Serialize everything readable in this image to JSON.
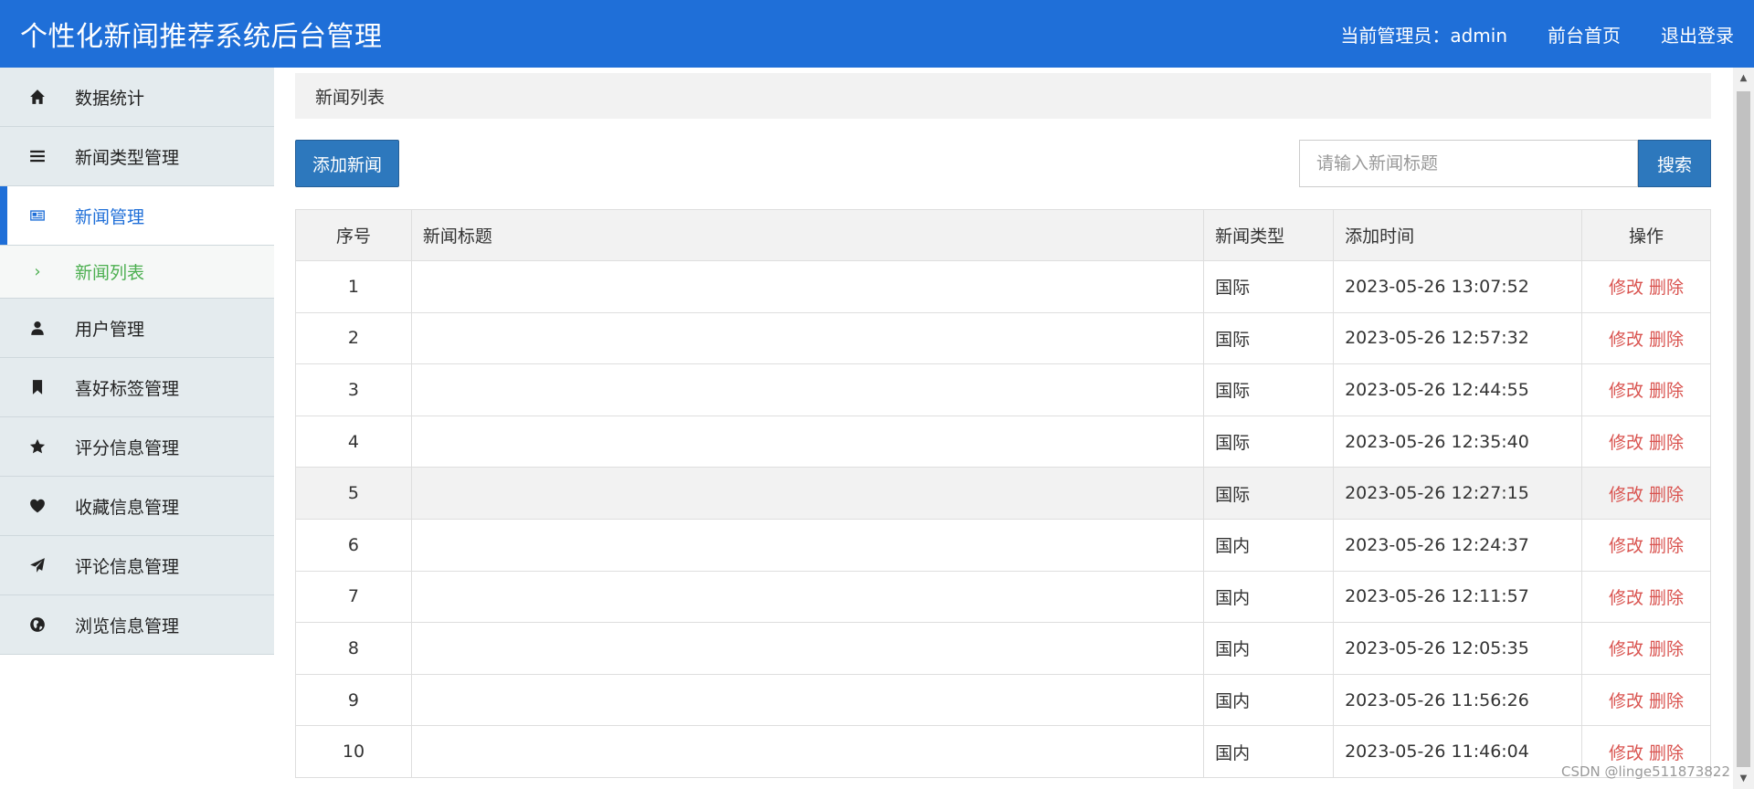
{
  "header": {
    "title": "个性化新闻推荐系统后台管理",
    "admin_label": "当前管理员：admin",
    "home_link": "前台首页",
    "logout_link": "退出登录"
  },
  "sidebar": {
    "items": [
      {
        "label": "数据统计",
        "icon": "home-icon"
      },
      {
        "label": "新闻类型管理",
        "icon": "menu-icon"
      },
      {
        "label": "新闻管理",
        "icon": "newspaper-icon",
        "active": true
      },
      {
        "label": "用户管理",
        "icon": "user-icon"
      },
      {
        "label": "喜好标签管理",
        "icon": "bookmark-icon"
      },
      {
        "label": "评分信息管理",
        "icon": "star-icon"
      },
      {
        "label": "收藏信息管理",
        "icon": "heart-icon"
      },
      {
        "label": "评论信息管理",
        "icon": "paper-plane-icon"
      },
      {
        "label": "浏览信息管理",
        "icon": "globe-icon"
      }
    ],
    "sub_item": "新闻列表"
  },
  "breadcrumb": "新闻列表",
  "toolbar": {
    "add_label": "添加新闻",
    "search_placeholder": "请输入新闻标题",
    "search_label": "搜索"
  },
  "table": {
    "headers": [
      "序号",
      "新闻标题",
      "新闻类型",
      "添加时间",
      "操作"
    ],
    "edit_label": "修改",
    "delete_label": "删除",
    "rows": [
      {
        "idx": "1",
        "title": "",
        "type": "国际",
        "time": "2023-05-26 13:07:52"
      },
      {
        "idx": "2",
        "title": "",
        "type": "国际",
        "time": "2023-05-26 12:57:32"
      },
      {
        "idx": "3",
        "title": "",
        "type": "国际",
        "time": "2023-05-26 12:44:55"
      },
      {
        "idx": "4",
        "title": "",
        "type": "国际",
        "time": "2023-05-26 12:35:40"
      },
      {
        "idx": "5",
        "title": "",
        "type": "国际",
        "time": "2023-05-26 12:27:15"
      },
      {
        "idx": "6",
        "title": "",
        "type": "国内",
        "time": "2023-05-26 12:24:37"
      },
      {
        "idx": "7",
        "title": "",
        "type": "国内",
        "time": "2023-05-26 12:11:57"
      },
      {
        "idx": "8",
        "title": "",
        "type": "国内",
        "time": "2023-05-26 12:05:35"
      },
      {
        "idx": "9",
        "title": "",
        "type": "国内",
        "time": "2023-05-26 11:56:26"
      },
      {
        "idx": "10",
        "title": "",
        "type": "国内",
        "time": "2023-05-26 11:46:04"
      }
    ]
  },
  "watermark": "CSDN @linge511873822"
}
